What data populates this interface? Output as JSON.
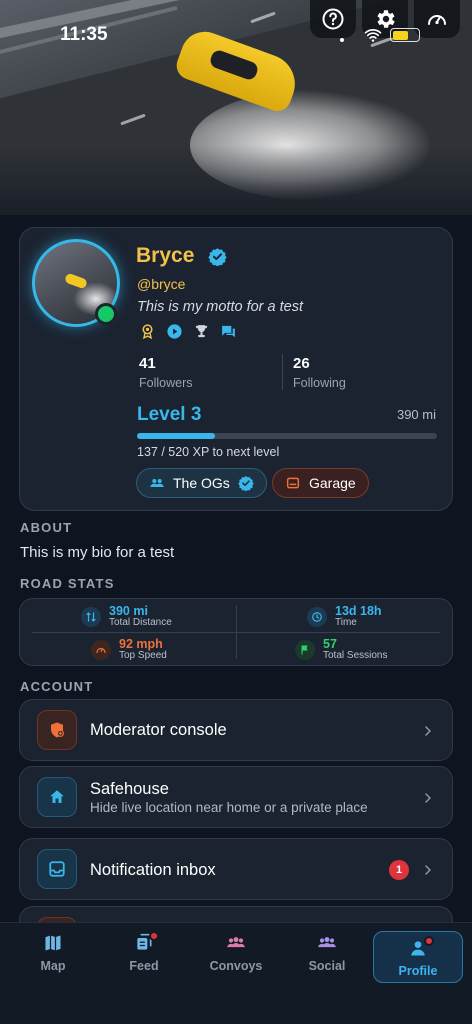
{
  "status_bar": {
    "time": "11:35"
  },
  "top_actions": [
    {
      "icon": "help-icon"
    },
    {
      "icon": "gear-icon"
    },
    {
      "icon": "speedometer-icon"
    }
  ],
  "profile": {
    "name": "Bryce",
    "handle": "@bryce",
    "motto": "This is my motto for a test",
    "followers_count": "41",
    "followers_label": "Followers",
    "following_count": "26",
    "following_label": "Following",
    "level": "Level 3",
    "total_miles": "390 mi",
    "xp_progress": 0.26,
    "xp_text": "137 / 520 XP to next level",
    "group_pill": "The OGs",
    "garage_pill": "Garage",
    "badge_icons": [
      "medal-icon",
      "play-icon",
      "trophy-icon",
      "chat-icon"
    ]
  },
  "about": {
    "label": "ABOUT",
    "bio": "This is my bio for a test"
  },
  "road_stats": {
    "label": "ROAD STATS",
    "items": [
      {
        "value": "390 mi",
        "label": "Total Distance",
        "color": "#39b7ec"
      },
      {
        "value": "13d 18h",
        "label": "Time",
        "color": "#39b7ec"
      },
      {
        "value": "92 mph",
        "label": "Top Speed",
        "color": "#f0703a"
      },
      {
        "value": "57",
        "label": "Total Sessions",
        "color": "#2fd072"
      }
    ]
  },
  "account": {
    "label": "ACCOUNT",
    "rows": [
      {
        "title": "Moderator console",
        "subtitle": ""
      },
      {
        "title": "Safehouse",
        "subtitle": "Hide live location near home or a private place"
      },
      {
        "title": "Notification inbox",
        "subtitle": "",
        "badge": "1"
      }
    ]
  },
  "tabs": [
    {
      "label": "Map"
    },
    {
      "label": "Feed"
    },
    {
      "label": "Convoys"
    },
    {
      "label": "Social"
    },
    {
      "label": "Profile"
    }
  ],
  "colors": {
    "accent": "#39b7ec",
    "gold": "#f2c14b",
    "alert": "#e0343d",
    "online": "#17c964"
  }
}
